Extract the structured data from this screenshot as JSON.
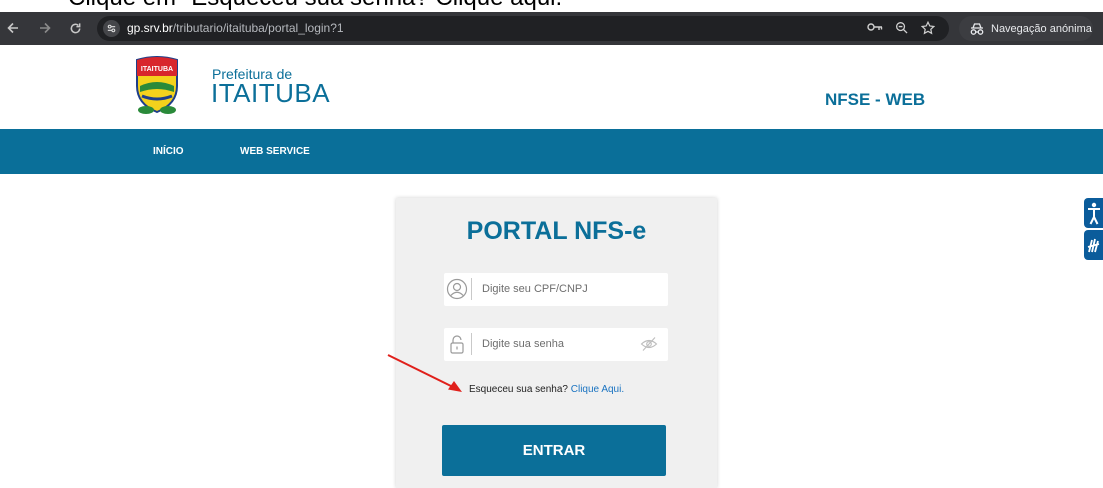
{
  "instruction": {
    "text": "Clique em \"Esqueceu sua senha? Clique aqui.\""
  },
  "browser": {
    "url_host": "gp.srv.br",
    "url_path": "/tributario/itaituba/portal_login?1",
    "incognito_label": "Navegação anónima",
    "icons": [
      "back-icon",
      "forward-icon",
      "reload-icon",
      "site-info-icon",
      "key-icon",
      "zoom-icon",
      "star-icon",
      "incognito-icon"
    ]
  },
  "header": {
    "prefeitura_label": "Prefeitura de",
    "city_name": "ITAITUBA",
    "logo_text": "ITAITUBA",
    "app_name": "NFSE - WEB"
  },
  "menu": {
    "items": [
      {
        "label": "INÍCIO"
      },
      {
        "label": "WEB SERVICE"
      }
    ]
  },
  "login": {
    "title": "PORTAL NFS-e",
    "cpf_placeholder": "Digite seu CPF/CNPJ",
    "password_placeholder": "Digite sua senha",
    "forgot_text": "Esqueceu sua senha?",
    "forgot_link": "Clique Aqui.",
    "submit_label": "ENTRAR"
  },
  "colors": {
    "brand": "#0b6f99",
    "menu_bg": "#0a6f99",
    "browser_bar": "#35363a",
    "card_bg": "#f0f0f0",
    "arrow": "#e0201b",
    "link": "#1a73c1"
  }
}
